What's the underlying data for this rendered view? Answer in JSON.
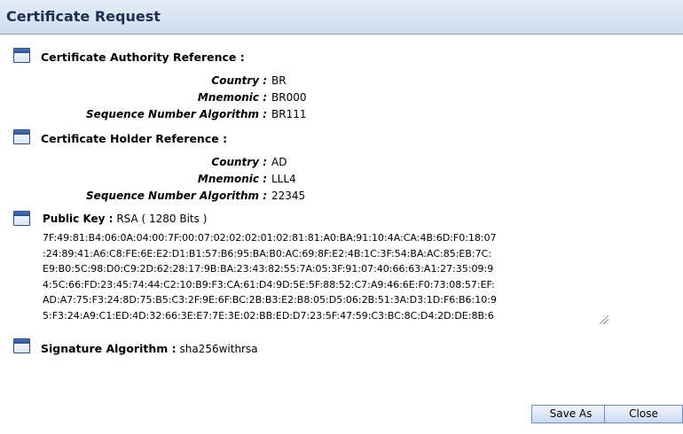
{
  "window": {
    "title": "Certificate Request"
  },
  "ca_reference": {
    "heading": "Certificate Authority Reference :",
    "fields": [
      {
        "label": "Country :",
        "value": "BR"
      },
      {
        "label": "Mnemonic :",
        "value": "BR000"
      },
      {
        "label": "Sequence Number Algorithm :",
        "value": "BR111"
      }
    ]
  },
  "holder_reference": {
    "heading": "Certificate Holder Reference :",
    "fields": [
      {
        "label": "Country :",
        "value": "AD"
      },
      {
        "label": "Mnemonic :",
        "value": "LLL4"
      },
      {
        "label": "Sequence Number Algorithm :",
        "value": "22345"
      }
    ]
  },
  "public_key": {
    "label": "Public Key :",
    "algorithm": "RSA ( 1280 Bits )",
    "lines": [
      "7F:49:81:B4:06:0A:04:00:7F:00:07:02:02:02:01:02:81:81:A0:BA:91:10:4A:CA:4B:6D:F0:18:07",
      ":24:89:41:A6:C8:FE:6E:E2:D1:B1:57:B6:95:BA:B0:AC:69:8F:E2:4B:1C:3F:54:BA:AC:85:EB:7C:",
      "E9:B0:5C:98:D0:C9:2D:62:28:17:9B:BA:23:43:82:55:7A:05:3F:91:07:40:66:63:A1:27:35:09:9",
      "4:5C:66:FD:23:45:74:44:C2:10:B9:F3:CA:61:D4:9D:5E:5F:88:52:C7:A9:46:6E:F0:73:08:57:EF:",
      "AD:A7:75:F3:24:8D:75:B5:C3:2F:9E:6F:BC:2B:B3:E2:B8:05:D5:06:2B:51:3A:D3:1D:F6:B6:10:9",
      "5:F3:24:A9:C1:ED:4D:32:66:3E:E7:7E:3E:02:BB:ED:D7:23:5F:47:59:C3:BC:8C:D4:2D:DE:8B:6"
    ]
  },
  "signature": {
    "label": "Signature Algorithm :",
    "value": "sha256withrsa"
  },
  "buttons": {
    "save_as": "Save As",
    "close": "Close"
  }
}
